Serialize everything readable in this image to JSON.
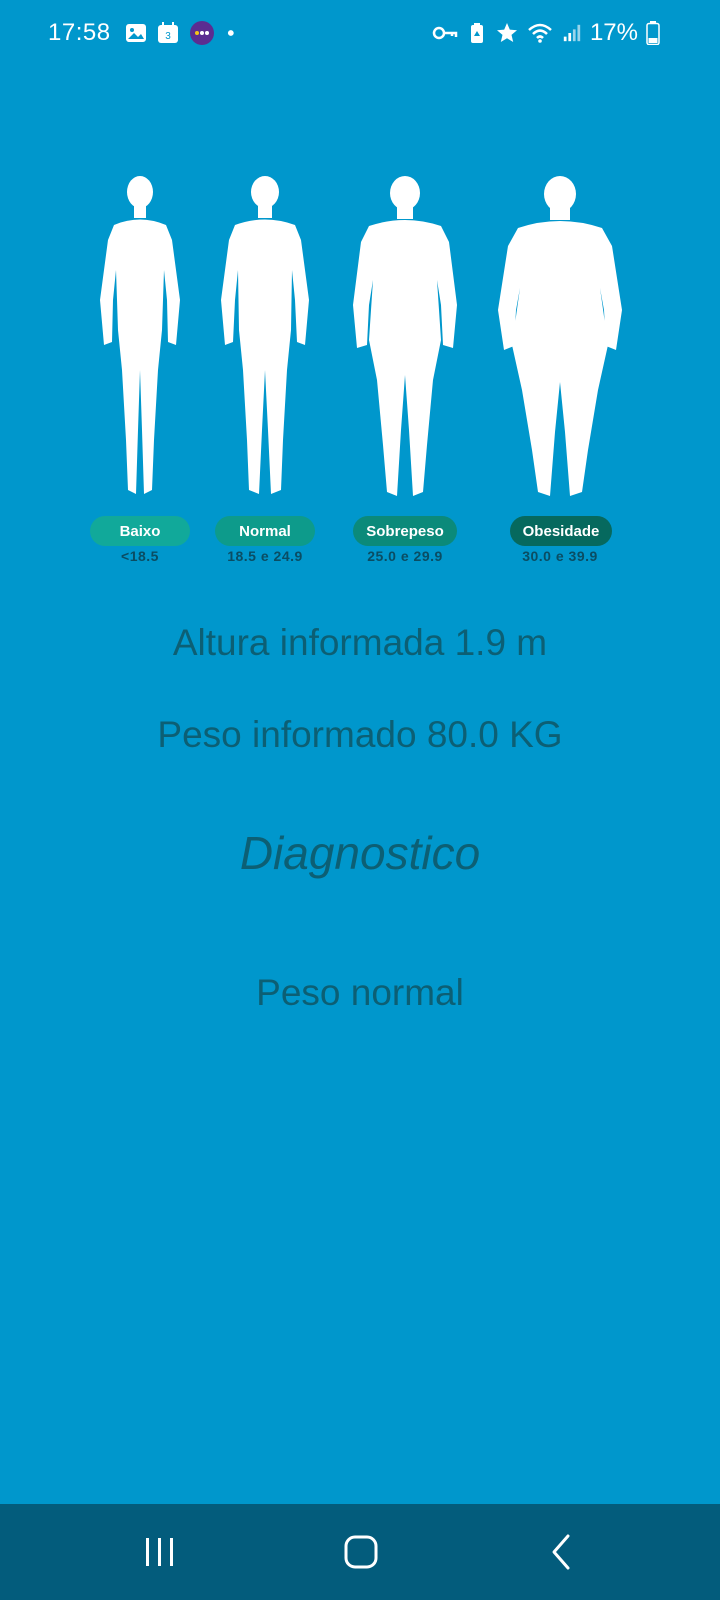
{
  "status_bar": {
    "time": "17:58",
    "calendar_day": "3",
    "battery_percent": "17%",
    "icons_left": [
      "gallery-icon",
      "calendar-icon",
      "app-badge-icon",
      "dot-icon"
    ],
    "icons_right": [
      "vpn-key-icon",
      "battery-saver-icon",
      "star-icon",
      "wifi-icon",
      "signal-icon",
      "battery-icon"
    ]
  },
  "categories": [
    {
      "label": "Baixo",
      "range": "<18.5",
      "color": "#11a99a"
    },
    {
      "label": "Normal",
      "range": "18.5 e 24.9",
      "color": "#0d9b8b"
    },
    {
      "label": "Sobrepeso",
      "range": "25.0 e 29.9",
      "color": "#0b8a7a"
    },
    {
      "label": "Obesidade",
      "range": "30.0 e 39.9",
      "color": "#06695e"
    }
  ],
  "info": {
    "height_text": "Altura informada 1.9 m",
    "weight_text": "Peso informado 80.0 KG"
  },
  "diagnosis": {
    "title": "Diagnostico",
    "result": "Peso normal"
  },
  "colors": {
    "background": "#0097cc",
    "text": "#0c5f74",
    "nav_bar": "#035c7c"
  },
  "nav_bar": {
    "buttons": [
      "recent-apps-icon",
      "home-icon",
      "back-icon"
    ]
  }
}
